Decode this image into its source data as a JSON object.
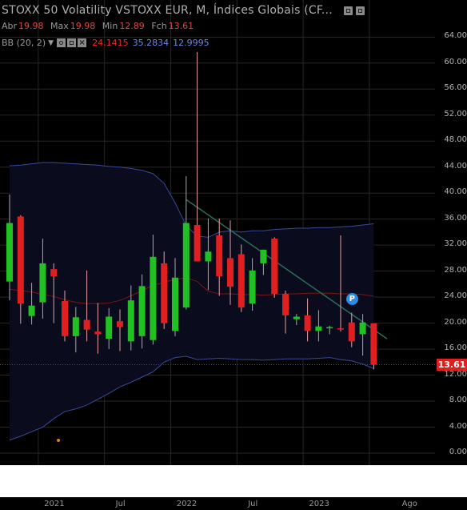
{
  "header": {
    "title": "STOXX 50 Volatility VSTOXX EUR, M, Índices Globais (CF..."
  },
  "ohlc": {
    "open_label": "Abr",
    "open": "19.98",
    "high_label": "Max",
    "high": "19.98",
    "low_label": "Min",
    "low": "12.89",
    "close_label": "Fch",
    "close": "13.61"
  },
  "indicator": {
    "label": "BB (20, 2)",
    "basis": "24.1415",
    "upper": "35.2834",
    "lower": "12.9995",
    "colors": {
      "basis": "#e0302a",
      "upper": "#6e86e0",
      "lower": "#6e86e0"
    }
  },
  "last_price_label": "13.61",
  "marker_label": "P",
  "colors": {
    "up": "#22c022",
    "down": "#e02020",
    "wick_up": "#a8a8a8",
    "wick_down": "#e8a0a0",
    "band_line": "#3a4a9a",
    "basis_line": "#7a1616",
    "trend_line": "#2a6e5a",
    "grid": "#262626",
    "price_line": "#c02020"
  },
  "chart_data": {
    "type": "candlestick",
    "interval": "M",
    "ylim": [
      0,
      64
    ],
    "y_ticks": [
      "0.00",
      "4.00",
      "8.00",
      "12.00",
      "16.00",
      "20.00",
      "24.00",
      "28.00",
      "32.00",
      "36.00",
      "40.00",
      "44.00",
      "48.00",
      "52.00",
      "56.00",
      "60.00",
      "64.00"
    ],
    "x_ticks": [
      "2021",
      "Jul",
      "2022",
      "Jul",
      "2023",
      "Ago"
    ],
    "candles": [
      {
        "o": 26.4,
        "h": 39.8,
        "l": 23.5,
        "c": 35.4
      },
      {
        "o": 36.4,
        "h": 36.6,
        "l": 19.9,
        "c": 23.0
      },
      {
        "o": 21.1,
        "h": 26.2,
        "l": 19.8,
        "c": 22.7
      },
      {
        "o": 23.2,
        "h": 33.0,
        "l": 20.7,
        "c": 29.2
      },
      {
        "o": 28.3,
        "h": 29.2,
        "l": 20.0,
        "c": 27.2
      },
      {
        "o": 23.4,
        "h": 25.0,
        "l": 17.2,
        "c": 18.0
      },
      {
        "o": 18.0,
        "h": 22.5,
        "l": 15.5,
        "c": 20.9
      },
      {
        "o": 20.5,
        "h": 28.1,
        "l": 17.2,
        "c": 19.0
      },
      {
        "o": 18.7,
        "h": 23.1,
        "l": 15.3,
        "c": 18.3
      },
      {
        "o": 17.6,
        "h": 22.3,
        "l": 16.0,
        "c": 21.0
      },
      {
        "o": 20.3,
        "h": 22.1,
        "l": 15.7,
        "c": 19.4
      },
      {
        "o": 17.2,
        "h": 25.8,
        "l": 15.8,
        "c": 23.5
      },
      {
        "o": 18.0,
        "h": 27.5,
        "l": 16.1,
        "c": 25.7
      },
      {
        "o": 17.4,
        "h": 33.6,
        "l": 16.7,
        "c": 30.2
      },
      {
        "o": 29.2,
        "h": 31.0,
        "l": 19.1,
        "c": 20.0
      },
      {
        "o": 18.8,
        "h": 30.0,
        "l": 18.0,
        "c": 27.0
      },
      {
        "o": 22.4,
        "h": 42.6,
        "l": 22.1,
        "c": 35.4
      },
      {
        "o": 35.1,
        "h": 61.7,
        "l": 29.5,
        "c": 29.5
      },
      {
        "o": 29.5,
        "h": 36.1,
        "l": 25.1,
        "c": 31.0
      },
      {
        "o": 33.5,
        "h": 36.1,
        "l": 24.2,
        "c": 27.2
      },
      {
        "o": 30.0,
        "h": 35.8,
        "l": 22.8,
        "c": 25.6
      },
      {
        "o": 30.6,
        "h": 32.1,
        "l": 21.7,
        "c": 22.4
      },
      {
        "o": 23.0,
        "h": 30.0,
        "l": 21.9,
        "c": 28.1
      },
      {
        "o": 29.2,
        "h": 31.3,
        "l": 27.4,
        "c": 31.3
      },
      {
        "o": 33.0,
        "h": 33.2,
        "l": 23.9,
        "c": 24.5
      },
      {
        "o": 24.5,
        "h": 25.0,
        "l": 18.4,
        "c": 21.2
      },
      {
        "o": 20.6,
        "h": 21.4,
        "l": 19.7,
        "c": 21.0
      },
      {
        "o": 21.2,
        "h": 23.8,
        "l": 17.2,
        "c": 18.8
      },
      {
        "o": 18.8,
        "h": 22.0,
        "l": 17.2,
        "c": 19.5
      },
      {
        "o": 19.2,
        "h": 19.6,
        "l": 18.3,
        "c": 19.4
      },
      {
        "o": 19.2,
        "h": 33.5,
        "l": 18.7,
        "c": 19.1
      },
      {
        "o": 20.1,
        "h": 21.6,
        "l": 16.3,
        "c": 17.2
      },
      {
        "o": 18.3,
        "h": 21.4,
        "l": 15.0,
        "c": 20.1
      },
      {
        "o": 19.98,
        "h": 19.98,
        "l": 12.89,
        "c": 13.61
      }
    ],
    "bb_upper": [
      44.2,
      44.3,
      44.5,
      44.7,
      44.7,
      44.6,
      44.5,
      44.4,
      44.3,
      44.1,
      44.0,
      43.8,
      43.5,
      43.0,
      41.5,
      38.5,
      35.0,
      33.4,
      33.2,
      34.0,
      34.2,
      34.0,
      34.2,
      34.2,
      34.4,
      34.5,
      34.6,
      34.6,
      34.7,
      34.7,
      34.8,
      34.9,
      35.1,
      35.28
    ],
    "bb_basis": [
      25.2,
      25.0,
      24.8,
      24.4,
      24.1,
      23.6,
      23.2,
      23.0,
      23.0,
      23.1,
      23.5,
      24.2,
      25.0,
      25.8,
      26.3,
      26.7,
      27.0,
      26.4,
      24.9,
      24.5,
      24.5,
      24.4,
      24.4,
      24.3,
      24.4,
      24.5,
      24.5,
      24.6,
      24.6,
      24.6,
      24.5,
      24.5,
      24.4,
      24.14
    ],
    "bb_lower": [
      2.0,
      2.6,
      3.3,
      4.0,
      5.3,
      6.4,
      6.8,
      7.4,
      8.3,
      9.2,
      10.2,
      10.9,
      11.7,
      12.5,
      14.0,
      14.7,
      14.9,
      14.4,
      14.5,
      14.6,
      14.5,
      14.4,
      14.4,
      14.3,
      14.4,
      14.5,
      14.5,
      14.5,
      14.6,
      14.7,
      14.4,
      14.2,
      13.7,
      13.0
    ],
    "trendline": {
      "from": {
        "i": 16,
        "y": 39.0
      },
      "to": {
        "i": 34.2,
        "y": 17.6
      }
    },
    "last_price": 13.61
  }
}
